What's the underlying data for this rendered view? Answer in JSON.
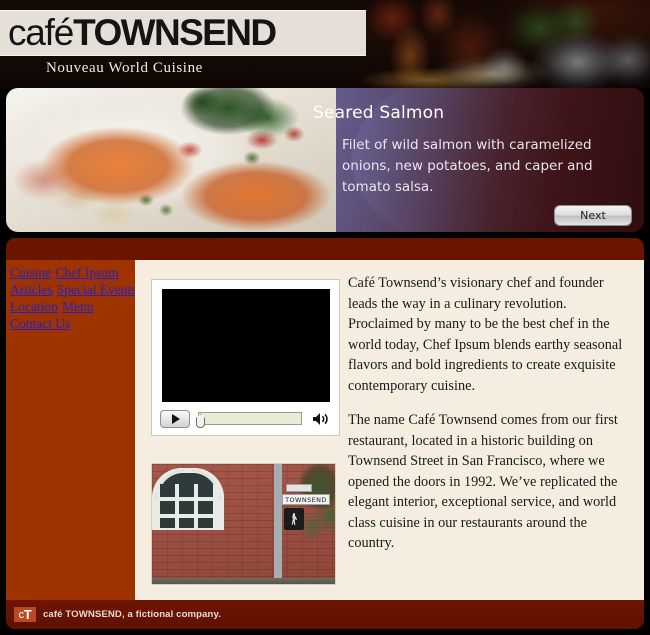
{
  "site": {
    "logo_cafe": "café",
    "logo_townsend": "TOWNSEND",
    "tagline": "Nouveau World Cuisine"
  },
  "hero": {
    "title": "Seared Salmon",
    "description": "Filet of wild salmon with caramelized onions, new potatoes, and caper and tomato salsa.",
    "next_label": "Next",
    "photo_alt": "seared-salmon-plate"
  },
  "nav": {
    "items": [
      {
        "label": "Cuisine"
      },
      {
        "label": "Chef Ipsum"
      },
      {
        "label": "Articles"
      },
      {
        "label": "Special Events"
      },
      {
        "label": "Location"
      },
      {
        "label": "Menu"
      },
      {
        "label": "Contact Us"
      }
    ]
  },
  "video": {
    "play_label": "play-button",
    "volume_label": "volume-icon",
    "seek_value": "0"
  },
  "street_photo": {
    "sign_text": "TOWNSEND",
    "alt": "brick-building-townsend-street-corner"
  },
  "body": {
    "paragraphs": [
      "Café Townsend’s visionary chef and founder leads the way in a culinary revolution. Proclaimed by many to be the best chef in the world today, Chef Ipsum blends earthy seasonal flavors and bold ingredients to create exquisite contemporary cuisine.",
      "The name Café Townsend comes from our first restaurant, located in a historic building on Townsend Street in San Francisco, where we opened the doors in 1992. We’ve replicated the elegant interior, exceptional service, and world class cuisine in our restaurants around the country."
    ]
  },
  "footer": {
    "logo_c": "c",
    "logo_t": "T",
    "text": "café TOWNSEND, a fictional company."
  },
  "colors": {
    "sidebar_rust": "#9E3300",
    "maroon_bar": "#6B1400",
    "content_cream": "#F5EDE0",
    "link_blue": "#2222CC",
    "footer_maroon": "#6F1503"
  }
}
